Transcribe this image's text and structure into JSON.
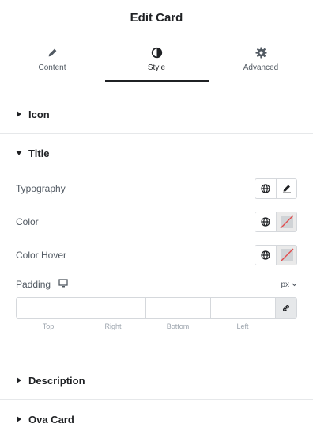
{
  "header": {
    "title": "Edit Card"
  },
  "tabs": [
    {
      "label": "Content",
      "icon": "pencil-icon",
      "active": false
    },
    {
      "label": "Style",
      "icon": "contrast-icon",
      "active": true
    },
    {
      "label": "Advanced",
      "icon": "gear-icon",
      "active": false
    }
  ],
  "sections": {
    "icon": {
      "title": "Icon",
      "expanded": false
    },
    "title": {
      "title": "Title",
      "expanded": true
    },
    "description": {
      "title": "Description",
      "expanded": false
    },
    "ova_card": {
      "title": "Ova Card",
      "expanded": false
    }
  },
  "title_controls": {
    "typography_label": "Typography",
    "color_label": "Color",
    "color_hover_label": "Color Hover",
    "padding_label": "Padding",
    "padding_unit": "px",
    "padding_values": {
      "top": "",
      "right": "",
      "bottom": "",
      "left": ""
    },
    "dim_labels": {
      "top": "Top",
      "right": "Right",
      "bottom": "Bottom",
      "left": "Left"
    }
  },
  "colors": {
    "accent": "#1f2124",
    "clear_slash": "#e34a4a"
  }
}
